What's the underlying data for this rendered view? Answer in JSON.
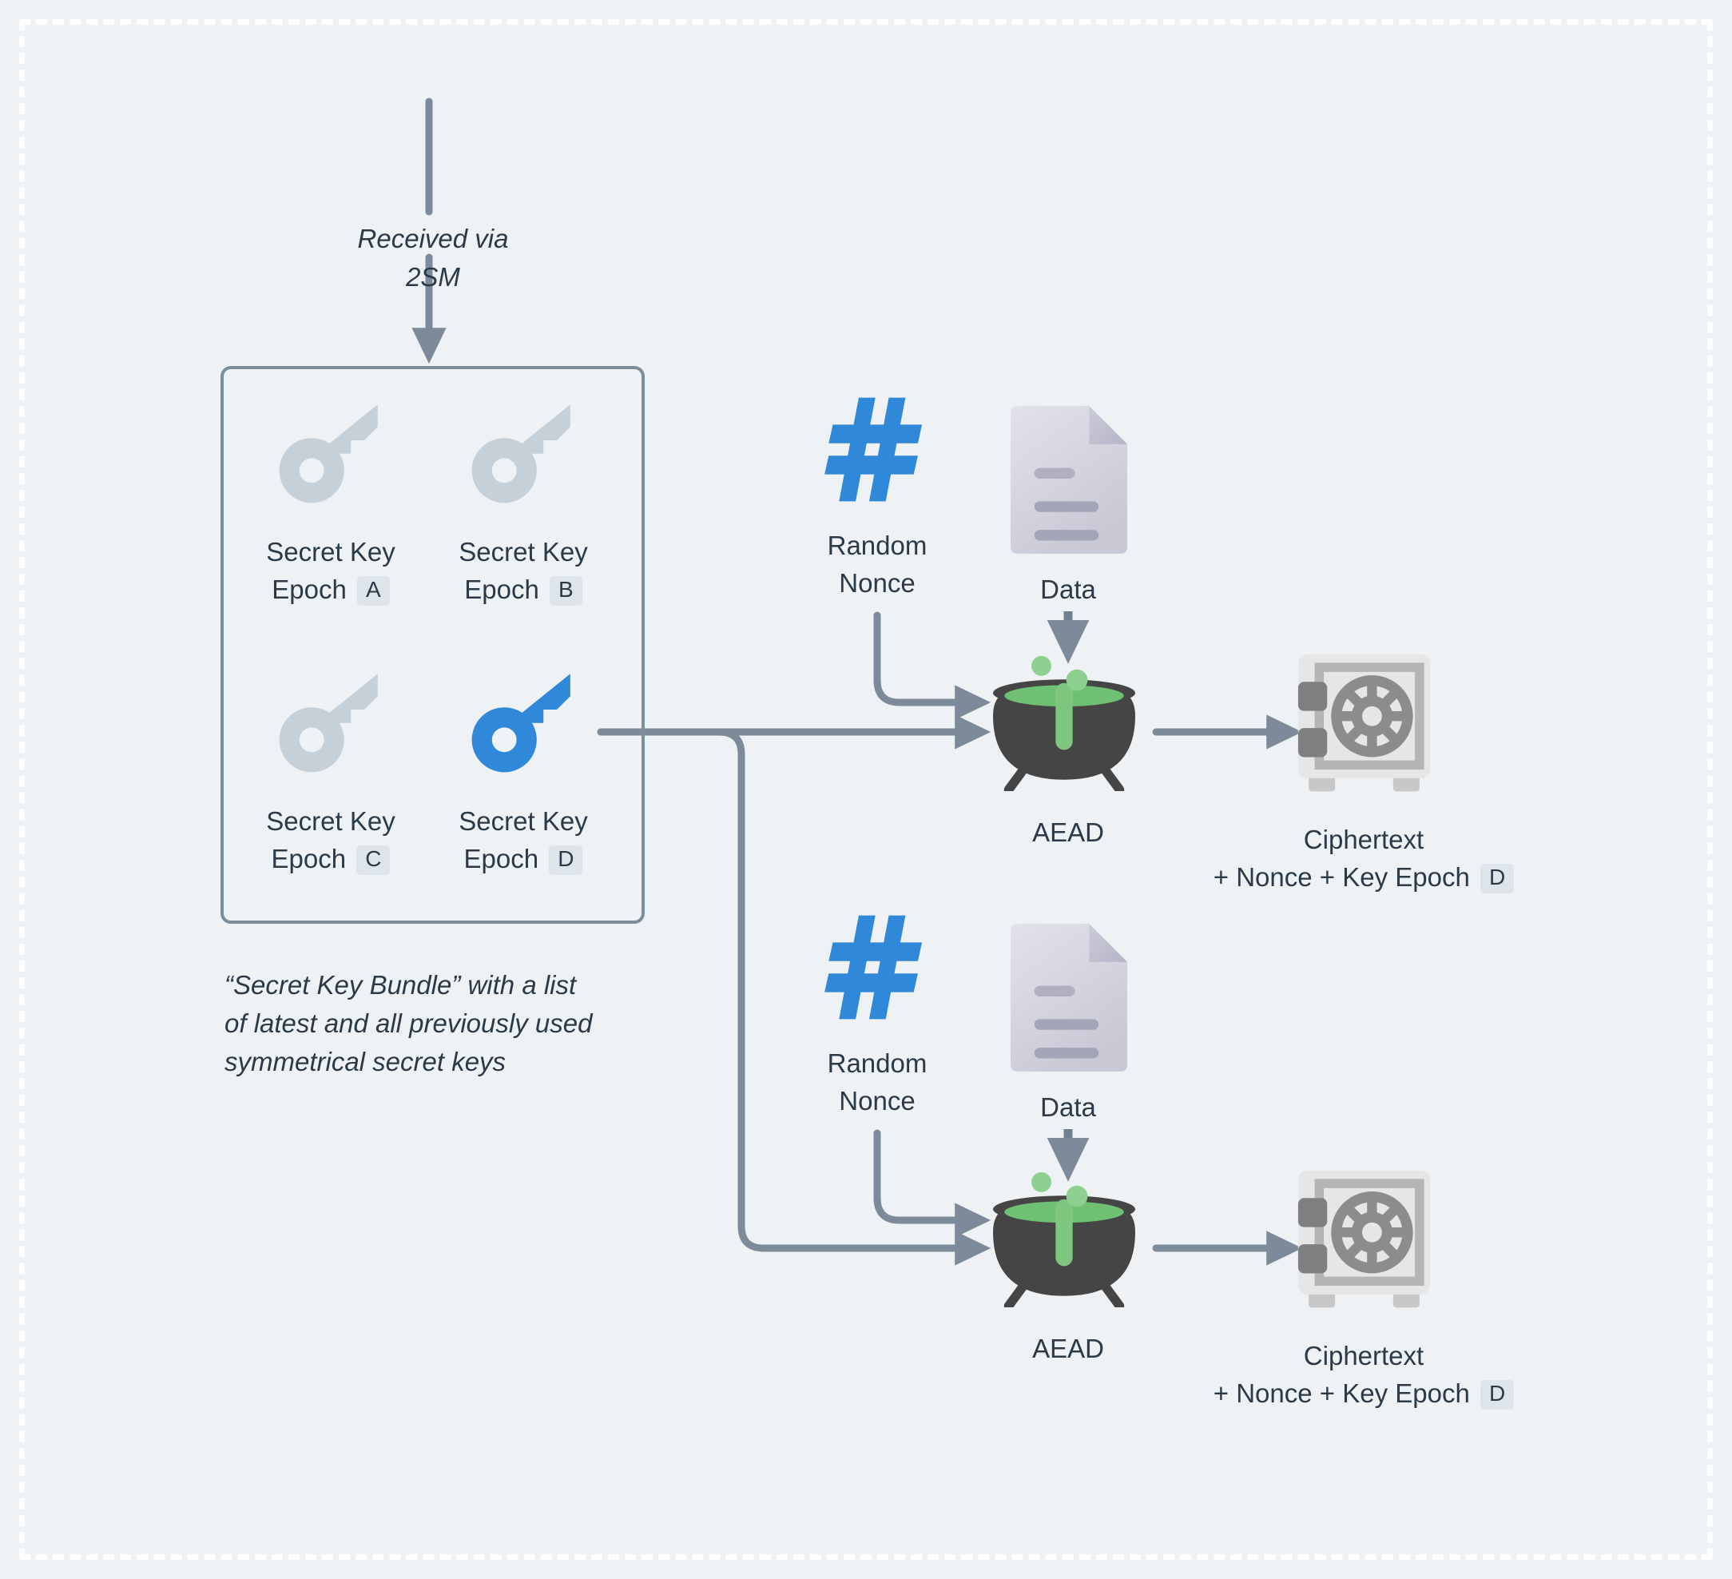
{
  "meta": {
    "background_color": "#eef2f5",
    "frame_color": "#ffffff",
    "connector_color": "#7c8a99",
    "accent_blue": "#2f88d8",
    "key_inactive_color": "#c6d0d8",
    "text_color": "#2b3a48",
    "badge_bg": "#dde4ea",
    "cauldron_body": "#454545",
    "cauldron_liquid": "#6fc072",
    "safe_body": "#e6e6e6",
    "safe_detail": "#8c8c8c"
  },
  "top_flow": {
    "arrow_label": "Received via 2SM"
  },
  "key_bundle": {
    "caption": "“Secret Key Bundle” with a list\nof latest and all previously used\nsymmetrical secret keys",
    "caption_lines": [
      "“Secret Key Bundle” with a list",
      "of latest and all previously used",
      "symmetrical secret keys"
    ],
    "keys": [
      {
        "title": "Secret Key",
        "subtitle": "Epoch",
        "epoch": "A",
        "active": false
      },
      {
        "title": "Secret Key",
        "subtitle": "Epoch",
        "epoch": "B",
        "active": false
      },
      {
        "title": "Secret Key",
        "subtitle": "Epoch",
        "epoch": "C",
        "active": false
      },
      {
        "title": "Secret Key",
        "subtitle": "Epoch",
        "epoch": "D",
        "active": true
      }
    ]
  },
  "pipelines": [
    {
      "nonce_label_line1": "Random",
      "nonce_label_line2": "Nonce",
      "data_label": "Data",
      "aead_label": "AEAD",
      "ciphertext_line1": "Ciphertext",
      "ciphertext_line2": "+ Nonce + Key Epoch",
      "ciphertext_epoch": "D"
    },
    {
      "nonce_label_line1": "Random",
      "nonce_label_line2": "Nonce",
      "data_label": "Data",
      "aead_label": "AEAD",
      "ciphertext_line1": "Ciphertext",
      "ciphertext_line2": "+ Nonce + Key Epoch",
      "ciphertext_epoch": "D"
    }
  ],
  "icons": {
    "key": "key-icon",
    "hash": "hash-icon",
    "document": "document-icon",
    "cauldron": "cauldron-icon",
    "safe": "safe-icon",
    "arrow": "arrow-icon"
  }
}
